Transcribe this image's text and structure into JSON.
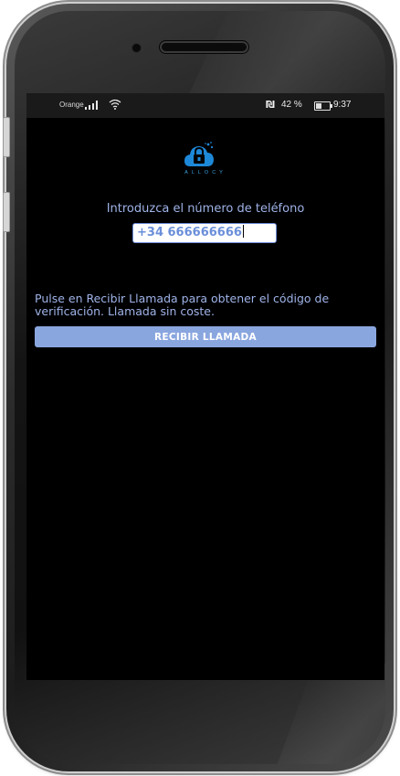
{
  "status_bar": {
    "carrier": "Orange",
    "battery_percent": "42 %",
    "battery_level": 0.42,
    "time": "9:37",
    "icons": [
      "signal-icon",
      "wifi-icon",
      "nfc-icon",
      "battery-icon"
    ]
  },
  "app": {
    "logo_text": "ALLOCY",
    "brand_color": "#1e88d8"
  },
  "main": {
    "prompt": "Introduzca el número de teléfono",
    "phone_value": "+34 666666666",
    "hint": "Pulse en Recibir Llamada para obtener el código de verificación. Llamada sin coste.",
    "call_button_label": "RECIBIR LLAMADA"
  },
  "colors": {
    "text_accent": "#9fb3e8",
    "button_bg": "#8aa6df",
    "screen_bg": "#000000"
  }
}
